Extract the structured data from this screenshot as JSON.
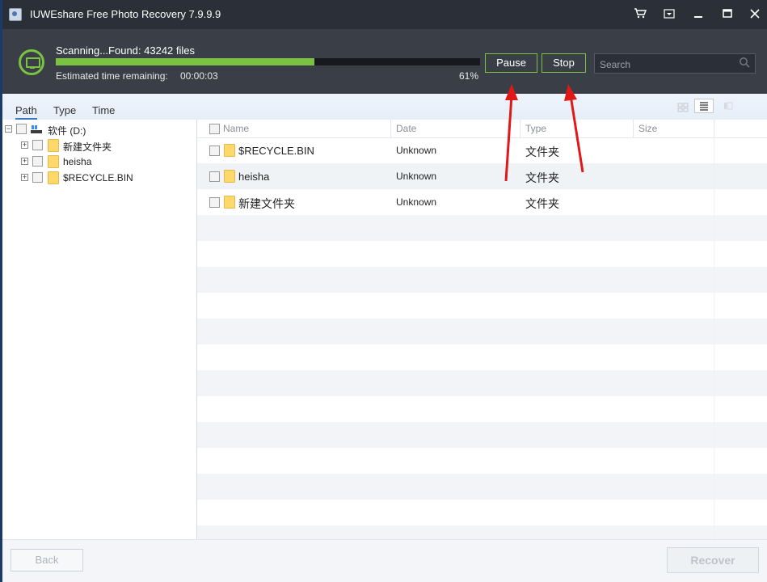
{
  "window": {
    "title": "IUWEshare Free Photo Recovery 7.9.9.9",
    "controls": {
      "cart_icon": "cart-icon",
      "menu_icon": "dropdown-menu-icon",
      "minimize": "—",
      "maximize": "□",
      "close": "✕"
    }
  },
  "scan": {
    "status_text": "Scanning...Found: 43242 files",
    "progress_fraction": 0.61,
    "estimated_label": "Estimated time remaining:",
    "estimated_value": "00:00:03",
    "percent_label": "61%",
    "pause_label": "Pause",
    "stop_label": "Stop",
    "search_placeholder": "Search",
    "accent_color": "#7bc142"
  },
  "tabs": [
    {
      "label": "Path",
      "active": true
    },
    {
      "label": "Type",
      "active": false
    },
    {
      "label": "Time",
      "active": false
    }
  ],
  "tree": {
    "root": {
      "label": "软件 (D:)",
      "expander": "−"
    },
    "children": [
      {
        "label": "新建文件夹",
        "expander": "+"
      },
      {
        "label": "heisha",
        "expander": "+"
      },
      {
        "label": "$RECYCLE.BIN",
        "expander": "+"
      }
    ]
  },
  "list": {
    "columns": [
      "Name",
      "Date",
      "Type",
      "Size"
    ],
    "rows": [
      {
        "name": "$RECYCLE.BIN",
        "date": "Unknown",
        "type": "文件夹",
        "size": ""
      },
      {
        "name": "heisha",
        "date": "Unknown",
        "type": "文件夹",
        "size": ""
      },
      {
        "name": "新建文件夹",
        "date": "Unknown",
        "type": "文件夹",
        "size": ""
      }
    ]
  },
  "footer": {
    "back_label": "Back",
    "recover_label": "Recover"
  },
  "annotation_color": "#e01818"
}
